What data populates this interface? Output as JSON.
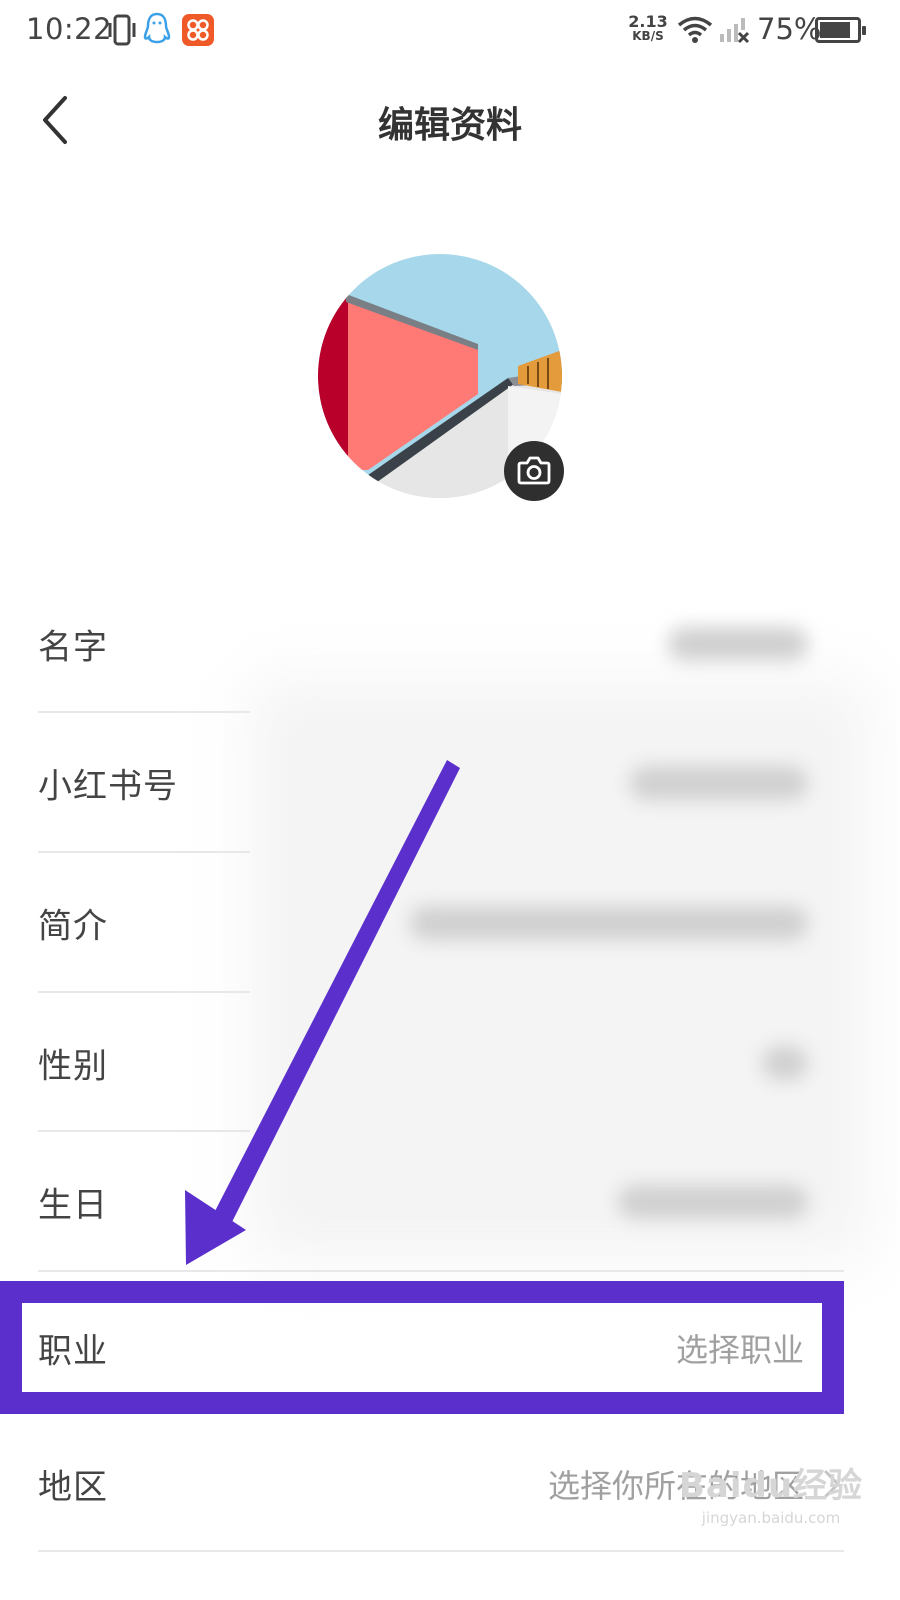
{
  "status_bar": {
    "time": "10:22",
    "net_speed_value": "2.13",
    "net_speed_unit": "KB/S",
    "battery": "75%",
    "icons": [
      "vibrate-icon",
      "qq-icon",
      "app-badge-icon",
      "wifi-icon",
      "signal-icon",
      "battery-icon"
    ]
  },
  "header": {
    "title": "编辑资料",
    "back_icon": "chevron-left-icon"
  },
  "avatar": {
    "camera_icon": "camera-icon"
  },
  "rows": [
    {
      "label": "名字"
    },
    {
      "label": "小红书号"
    },
    {
      "label": "简介"
    },
    {
      "label": "性别"
    },
    {
      "label": "生日"
    },
    {
      "label": "职业",
      "value": "选择职业"
    },
    {
      "label": "地区",
      "value": "选择你所在的地区",
      "icon": "chevron-right-icon"
    }
  ],
  "annotation": {
    "highlight_color": "#5a2fcc"
  },
  "watermark": {
    "main": "Baidu经验",
    "sub": "jingyan.baidu.com"
  }
}
